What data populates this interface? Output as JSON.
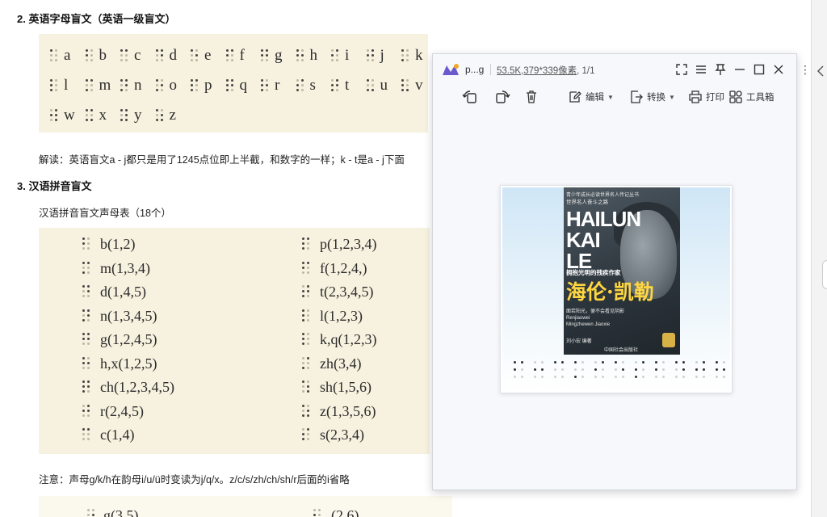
{
  "document": {
    "section2": {
      "heading": "2. 英语字母盲文（英语一级盲文）",
      "braille_letters": [
        "a",
        "b",
        "c",
        "d",
        "e",
        "f",
        "g",
        "h",
        "i",
        "j",
        "k",
        "l",
        "m",
        "n",
        "o",
        "p",
        "q",
        "r",
        "s",
        "t",
        "u",
        "v",
        "w",
        "x",
        "y",
        "z"
      ],
      "explanation": "解读：英语盲文a - j都只是用了1245点位即上半截，和数字的一样；k - t是a - j下面"
    },
    "section3": {
      "heading": "3. 汉语拼音盲文",
      "subheading": "汉语拼音盲文声母表（18个）",
      "initials_left": [
        "b(1,2)",
        "m(1,3,4)",
        "d(1,4,5)",
        "n(1,3,4,5)",
        "g(1,2,4,5)",
        "h,x(1,2,5)",
        "ch(1,2,3,4,5)",
        "r(2,4,5)",
        "c(1,4)"
      ],
      "initials_right": [
        "p(1,2,3,4)",
        "f(1,2,4,)",
        "t(2,3,4,5)",
        "l(1,2,3)",
        "k,q(1,2,3)",
        "zh(3,4)",
        "sh(1,5,6)",
        "z(1,3,5,6)",
        "s(2,3,4)"
      ],
      "note": "注意：声母g/k/h在韵母i/u/ü时变读为j/q/x。z/c/s/zh/ch/sh/r后面的i省略",
      "partial_next_left": "g(3,5)",
      "partial_next_right": "(2,6)"
    }
  },
  "viewer": {
    "file_name": "p...g",
    "file_size": "53.5K",
    "dimensions": "379*339像素",
    "page_info": ", 1/1",
    "toolbar": {
      "edit_label": "编辑",
      "convert_label": "转换",
      "print_label": "打印",
      "toolbox_label": "工具箱"
    },
    "cover": {
      "top_text": "青少年成长必读世界名人传记丛书",
      "series": "世界名人奋斗之路",
      "latin_title_1": "HAILUN",
      "latin_title_2": "KAI",
      "latin_title_3": "LE",
      "tagline": "拥抱光明的残疾作家",
      "title_cn": "海伦·凯勒",
      "quote": "面若阳光，便不会看见阴影",
      "latin_small": "Renjiaowei Mingzhewen Jiaoxie",
      "author": "刘小宏 编著",
      "publisher": "中国社会出版社"
    },
    "accent_color": "#6a5acd"
  }
}
